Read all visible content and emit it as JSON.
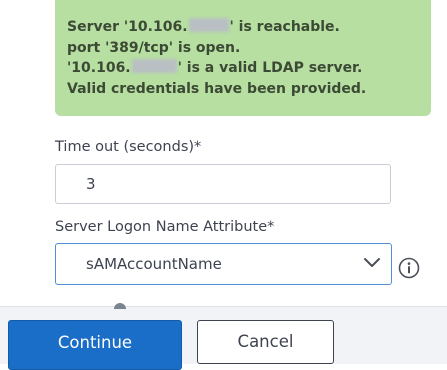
{
  "status": {
    "line1_before": "Server '10.106.",
    "line1_after": "' is reachable.",
    "line2": "port '389/tcp' is open.",
    "line3_before": "'10.106.",
    "line3_after": "' is a valid LDAP server.",
    "line4": "Valid credentials have been provided.",
    "background_color": "#b6dfa1"
  },
  "timeout": {
    "label": "Time out (seconds)*",
    "value": "3"
  },
  "logon_attribute": {
    "label": "Server Logon Name Attribute*",
    "selected": "sAMAccountName",
    "icon": "chevron-down-icon"
  },
  "info": {
    "icon": "info-icon"
  },
  "footer": {
    "continue_label": "Continue",
    "cancel_label": "Cancel",
    "accent_color": "#1a6ec7"
  }
}
